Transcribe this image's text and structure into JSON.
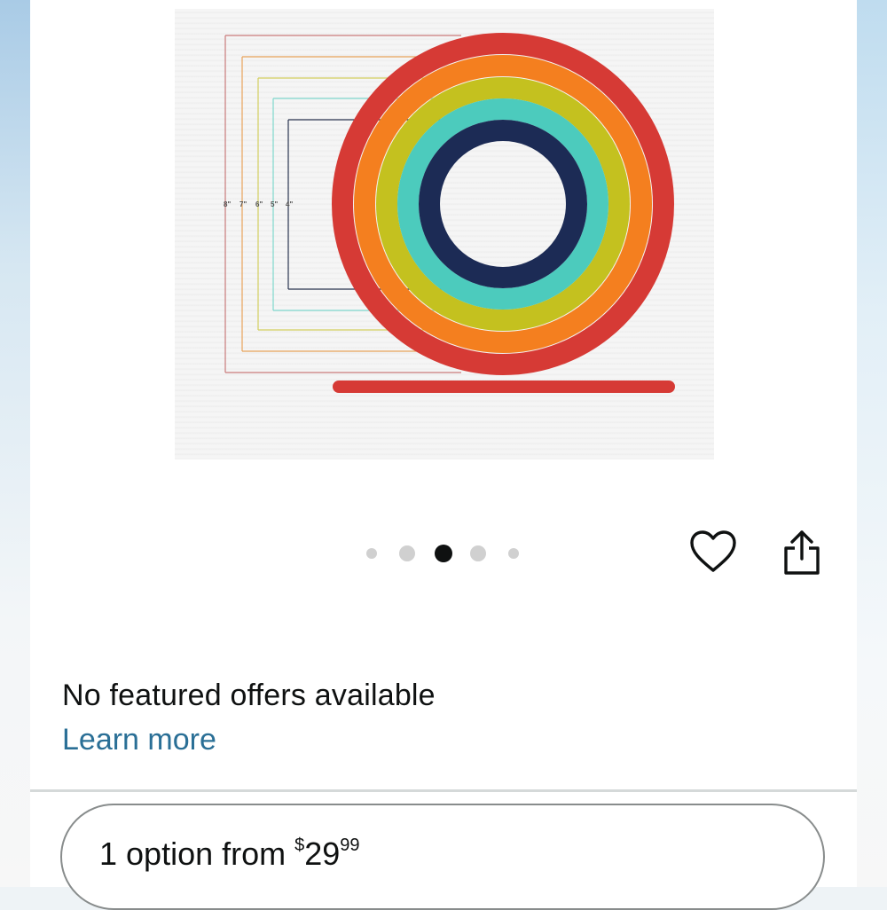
{
  "product_image": {
    "alt": "Set of five nested silicone trivet rings",
    "size_labels": [
      "8\"",
      "7\"",
      "6\"",
      "5\"",
      "4\""
    ],
    "ring_colors": [
      "#d63a35",
      "#f47f1f",
      "#c4c11f",
      "#4ccbbd",
      "#1c2b55"
    ]
  },
  "carousel": {
    "total_images": 5,
    "active_index": 2
  },
  "actions": {
    "wishlist_icon": "heart-outline-icon",
    "share_icon": "share-icon"
  },
  "offers": {
    "message": "No featured offers available",
    "learn_more": "Learn more"
  },
  "options_button": {
    "label": "1 option from",
    "price_symbol": "$",
    "price_whole": "29",
    "price_fraction": "99"
  }
}
